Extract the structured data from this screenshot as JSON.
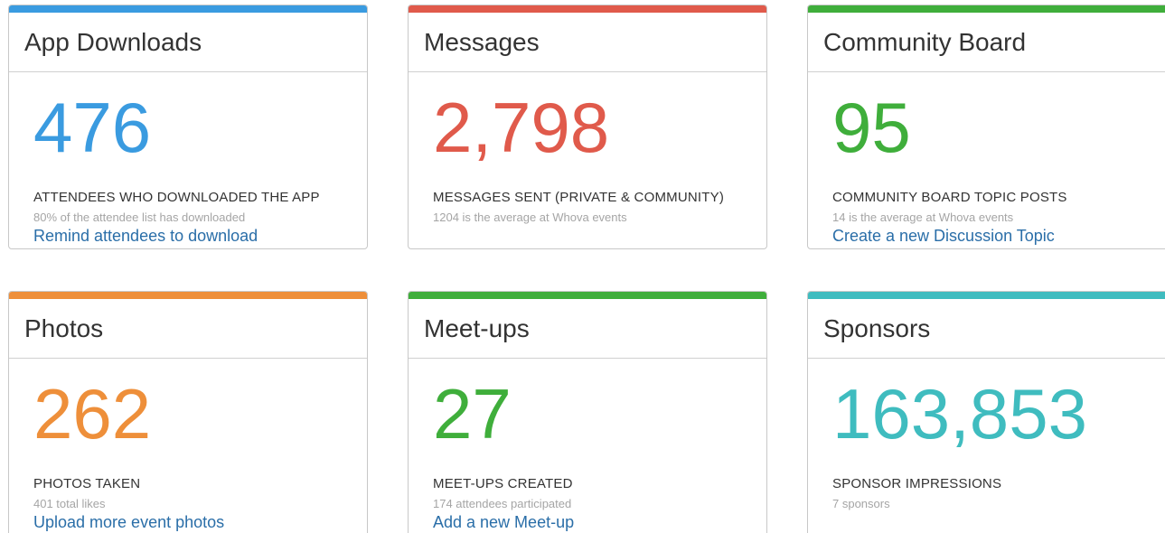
{
  "cards": [
    {
      "title": "App Downloads",
      "metric": "476",
      "label": "ATTENDEES WHO DOWNLOADED THE APP",
      "sub": "80% of the attendee list has downloaded",
      "link": "Remind attendees to download",
      "color": "#3a9be0"
    },
    {
      "title": "Messages",
      "metric": "2,798",
      "label": "MESSAGES SENT (PRIVATE & COMMUNITY)",
      "sub": "1204 is the average at Whova events",
      "link": "",
      "color": "#e05a4b"
    },
    {
      "title": "Community Board",
      "metric": "95",
      "label": "COMMUNITY BOARD TOPIC POSTS",
      "sub": "14 is the average at Whova events",
      "link": "Create a new Discussion Topic",
      "color": "#3fae3b"
    },
    {
      "title": "Photos",
      "metric": "262",
      "label": "PHOTOS TAKEN",
      "sub": "401 total likes",
      "link": "Upload more event photos",
      "color": "#ee8f3a"
    },
    {
      "title": "Meet-ups",
      "metric": "27",
      "label": "MEET-UPS CREATED",
      "sub": "174 attendees participated",
      "link": "Add a new Meet-up",
      "color": "#3fae3b"
    },
    {
      "title": "Sponsors",
      "metric": "163,853",
      "label": "SPONSOR IMPRESSIONS",
      "sub": "7 sponsors",
      "link": "",
      "color": "#3fbcbf"
    }
  ]
}
